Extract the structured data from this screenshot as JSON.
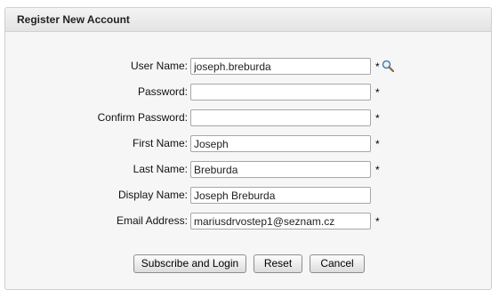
{
  "panel": {
    "title": "Register New Account"
  },
  "fields": [
    {
      "label": "User Name:",
      "value": "joseph.breburda",
      "required": "*"
    },
    {
      "label": "Password:",
      "value": "",
      "required": "*"
    },
    {
      "label": "Confirm Password:",
      "value": "",
      "required": "*"
    },
    {
      "label": "First Name:",
      "value": "Joseph",
      "required": "*"
    },
    {
      "label": "Last Name:",
      "value": "Breburda",
      "required": "*"
    },
    {
      "label": "Display Name:",
      "value": "Joseph Breburda",
      "required": ""
    },
    {
      "label": "Email Address:",
      "value": "mariusdrvostep1@seznam.cz",
      "required": "*"
    }
  ],
  "icons": {
    "lookup": "magnifier-icon"
  },
  "buttons": {
    "subscribe": "Subscribe and Login",
    "reset": "Reset",
    "cancel": "Cancel"
  }
}
